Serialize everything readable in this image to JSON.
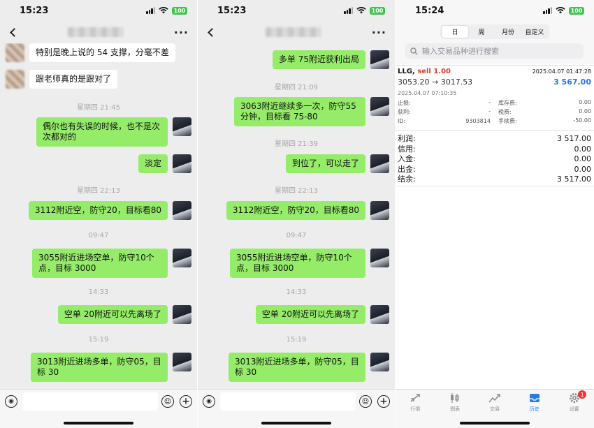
{
  "chat1": {
    "time": "15:23",
    "battery": "100",
    "messages": {
      "m1": "特别是晚上说的 54 支撑，分毫不差",
      "m2": "跟老师真的是跟对了",
      "t1": "星期四 21:45",
      "m3": "偶尔也有失误的时候，也不是次次都对的",
      "m4": "淡定",
      "t2": "星期四 22:13",
      "m5": "3112附近空，防守20，目标看80",
      "t3": "09:47",
      "m6": "3055附近进场空单，防守10个点，目标 3000",
      "t4": "14:33",
      "m7": "空单 20附近可以先离场了",
      "t5": "15:19",
      "m8": "3013附近进场多单，防守05，目标 30"
    }
  },
  "chat2": {
    "time": "15:23",
    "battery": "100",
    "messages": {
      "m1": "多单 75附近获利出局",
      "t1": "星期四 21:09",
      "m2": "3063附近继续多一次，防守55分钟，目标看 75-80",
      "t2": "星期四 21:39",
      "m3": "到位了，可以走了",
      "t3": "星期四 22:13",
      "m4": "3112附近空，防守20，目标看80",
      "t4": "09:47",
      "m5": "3055附近进场空单，防守10个点，目标 3000",
      "t5": "14:33",
      "m6": "空单 20附近可以先离场了",
      "t6": "15:19",
      "m7": "3013附近进场多单，防守05，目标 30"
    }
  },
  "trade": {
    "time": "15:24",
    "battery": "100",
    "segments": [
      "日",
      "周",
      "月份",
      "自定义"
    ],
    "search_placeholder": "输入交易品种进行搜索",
    "symbol": "LLG,",
    "side": "sell 1.00",
    "close_time": "2025.04.07 01:47:28",
    "prices": "3053.20 → 3017.53",
    "profit": "3 567.00",
    "open_time": "2025.04.07 07:10:35",
    "details": {
      "sl_label": "止损:",
      "sl": "-",
      "storage_label": "库存费:",
      "storage": "0.00",
      "tp_label": "获利:",
      "tp": "-",
      "tax_label": "税费:",
      "tax": "0.00",
      "id_label": "ID:",
      "id": "9303814",
      "fee_label": "手续费:",
      "fee": "-50.00"
    },
    "summary": {
      "profit_label": "利润:",
      "profit": "3 517.00",
      "credit_label": "信用:",
      "credit": "0.00",
      "deposit_label": "入金:",
      "deposit": "0.00",
      "withdraw_label": "出金:",
      "withdraw": "0.00",
      "balance_label": "结余:",
      "balance": "3 517.00"
    },
    "tabs": [
      "行情",
      "图表",
      "交易",
      "历史",
      "设置"
    ],
    "badge": "1",
    "accent": "#2a7ae2",
    "sell_color": "#e03a2f"
  }
}
